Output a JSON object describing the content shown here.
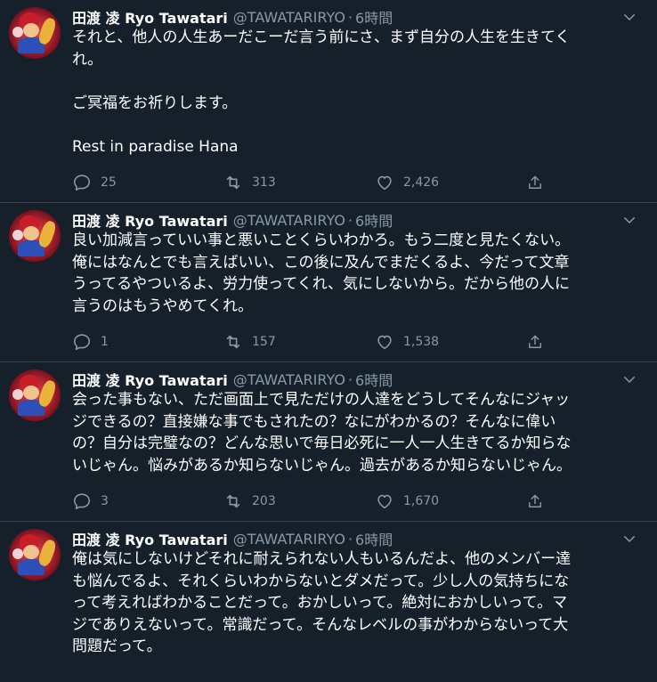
{
  "tweets": [
    {
      "name": "田渡 凌 Ryo Tawatari",
      "handle": "@TAWATARIRYO",
      "separator": "·",
      "time": "6時間",
      "lines": [
        "それと、他人の人生あーだこーだ言う前にさ、まず自分の人生を生きてく",
        "れ。",
        "",
        "ご冥福をお祈りします。",
        "",
        "Rest in paradise Hana"
      ],
      "replies": "25",
      "retweets": "313",
      "likes": "2,426"
    },
    {
      "name": "田渡 凌 Ryo Tawatari",
      "handle": "@TAWATARIRYO",
      "separator": "·",
      "time": "6時間",
      "lines": [
        "良い加減言っていい事と悪いことくらいわかろ。もう二度と見たくない。",
        "俺にはなんとでも言えばいい、この後に及んでまだくるよ、今だって文章",
        "うってるやついるよ、労力使ってくれ、気にしないから。だから他の人に",
        "言うのはもうやめてくれ。"
      ],
      "replies": "1",
      "retweets": "157",
      "likes": "1,538"
    },
    {
      "name": "田渡 凌 Ryo Tawatari",
      "handle": "@TAWATARIRYO",
      "separator": "·",
      "time": "6時間",
      "lines": [
        "会った事もない、ただ画面上で見ただけの人達をどうしてそんなにジャッ",
        "ジできるの？直接嫌な事でもされたの？なにがわかるの？そんなに偉い",
        "の？自分は完璧なの？どんな思いで毎日必死に一人一人生きてるか知らな",
        "いじゃん。悩みがあるか知らないじゃん。過去があるか知らないじゃん。"
      ],
      "replies": "3",
      "retweets": "203",
      "likes": "1,670"
    },
    {
      "name": "田渡 凌 Ryo Tawatari",
      "handle": "@TAWATARIRYO",
      "separator": "·",
      "time": "6時間",
      "lines": [
        "俺は気にしないけどそれに耐えられない人もいるんだよ、他のメンバー達",
        "も悩んでるよ、それくらいわからないとダメだって。少し人の気持ちにな",
        "って考えればわかることだって。おかしいって。絶対におかしいって。マ",
        "ジでありえないって。常識だって。そんなレベルの事がわからないって大",
        "問題だって。"
      ],
      "replies": "",
      "retweets": "",
      "likes": ""
    }
  ],
  "icons": {
    "avatar": "profile-avatar",
    "more": "chevron-down-icon",
    "reply": "reply-icon",
    "retweet": "retweet-icon",
    "like": "heart-icon",
    "share": "share-icon"
  },
  "colors": {
    "background": "#15202b",
    "text": "#ffffff",
    "muted": "#8899a6",
    "divider": "#38444d"
  }
}
